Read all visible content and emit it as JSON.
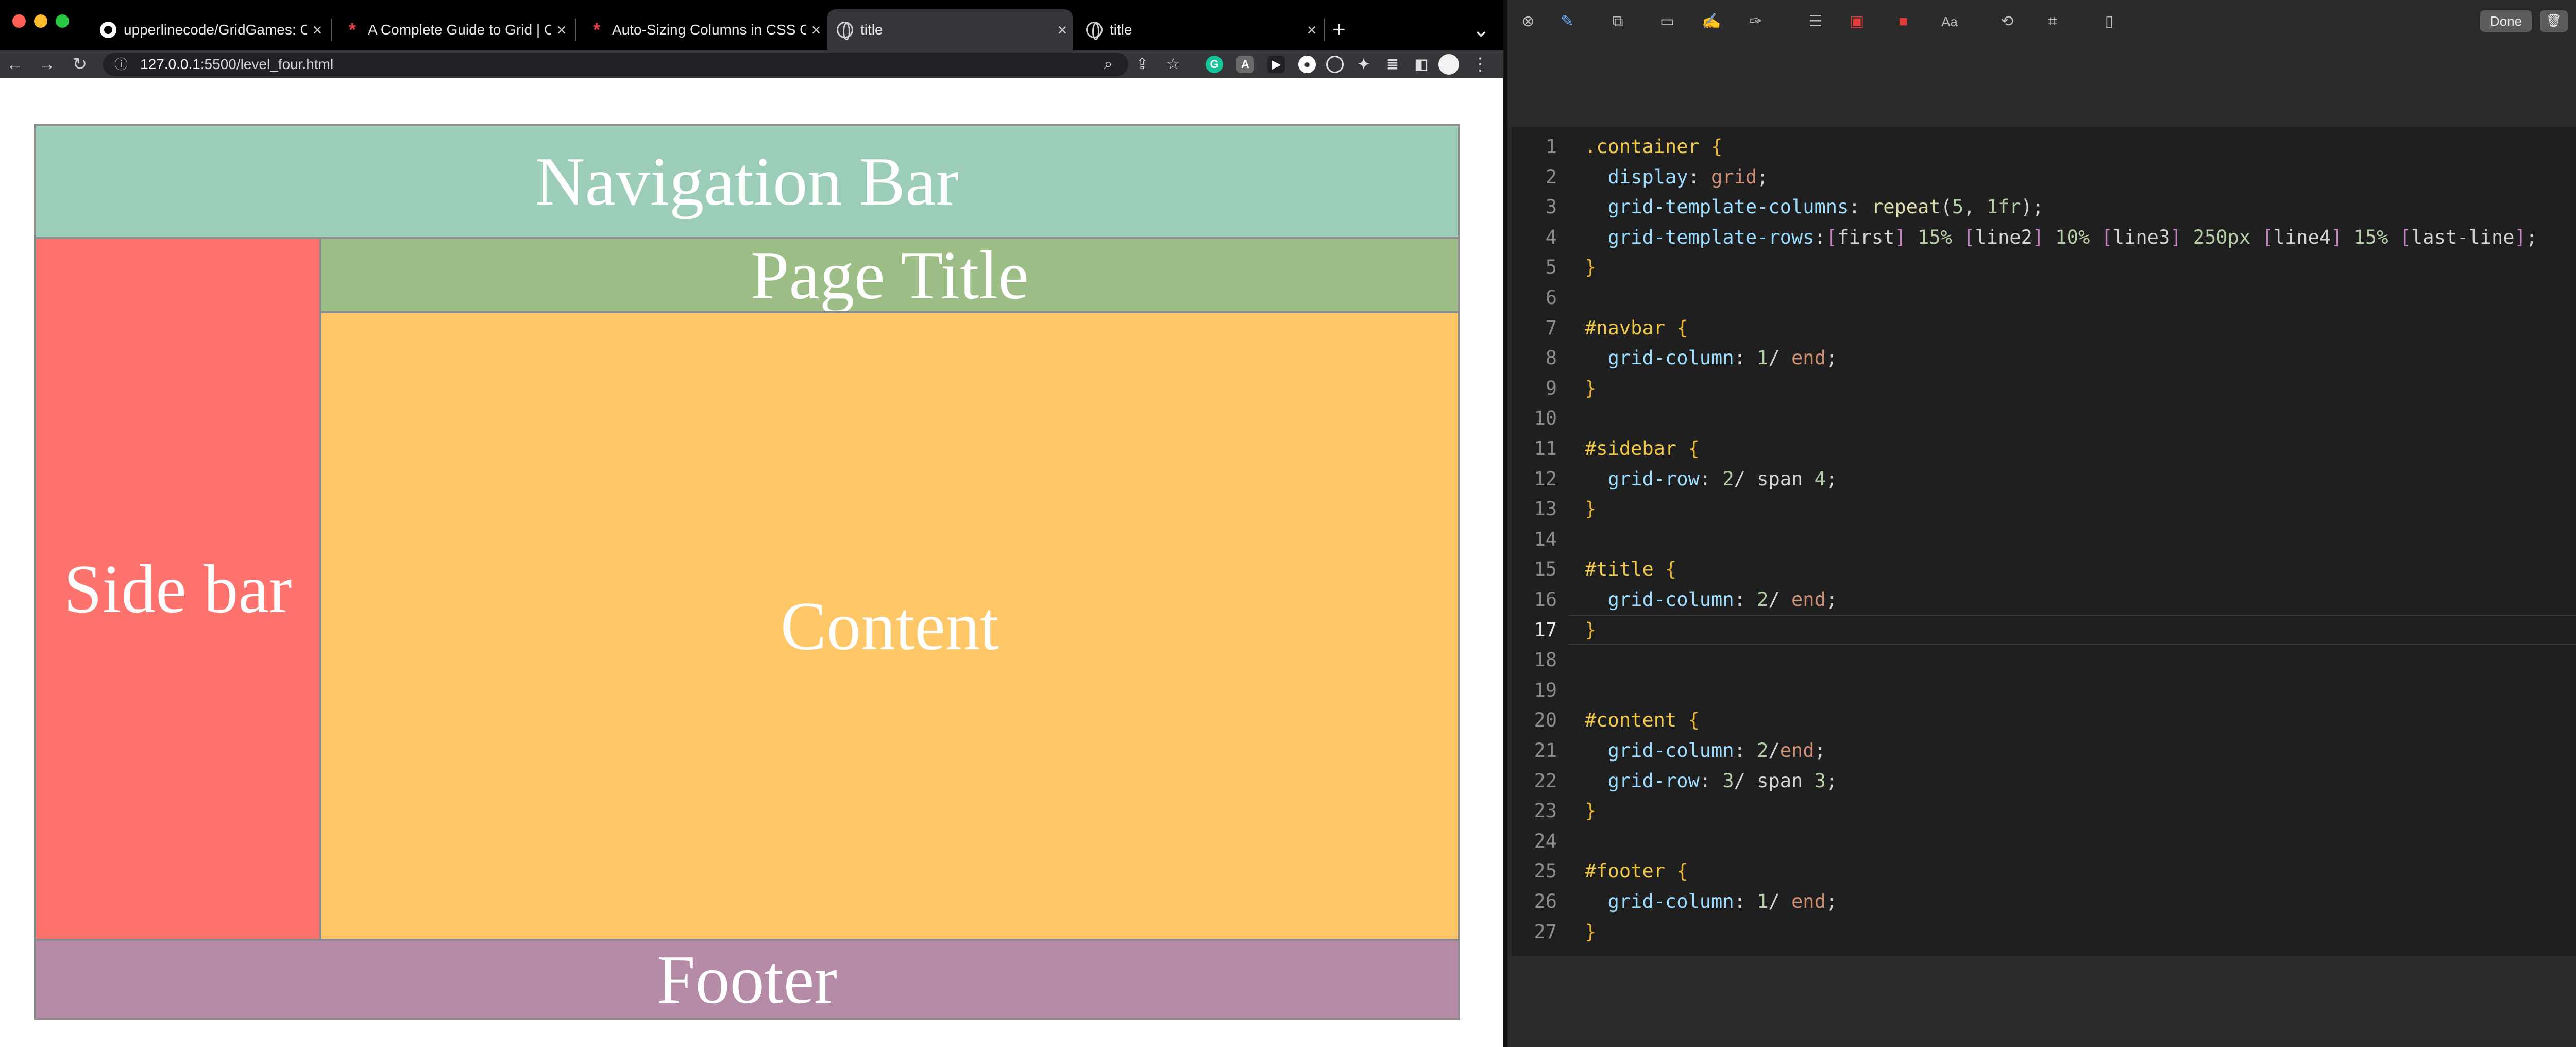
{
  "browser": {
    "tabs": [
      {
        "label": "upperlinecode/GridGames: CS",
        "favicon": "github-icon",
        "active": false
      },
      {
        "label": "A Complete Guide to Grid | CS",
        "favicon": "css-tricks-icon",
        "active": false
      },
      {
        "label": "Auto-Sizing Columns in CSS G",
        "favicon": "css-tricks-icon",
        "active": false
      },
      {
        "label": "title",
        "favicon": "globe-icon",
        "active": true
      },
      {
        "label": "title",
        "favicon": "globe-icon",
        "active": false
      }
    ],
    "new_tab_label": "+",
    "tab_list_label": "⌄",
    "url_host": "127.0.0.1",
    "url_rest": ":5500/level_four.html"
  },
  "page": {
    "navbar": "Navigation Bar",
    "sidebar": "Side bar",
    "title": "Page Title",
    "content": "Content",
    "footer": "Footer",
    "colors": {
      "navbar": "#9ccdb8",
      "sidebar": "#fe736e",
      "title": "#9dbd87",
      "content": "#fec868",
      "footer": "#b58aa6"
    }
  },
  "editor": {
    "done_label": "Done",
    "current_line": 17,
    "code_lines": [
      [
        {
          "t": ".container",
          "c": "sel"
        },
        {
          "t": " {",
          "c": "brk"
        }
      ],
      [
        {
          "t": "  "
        },
        {
          "t": "display",
          "c": "prop"
        },
        {
          "t": ": "
        },
        {
          "t": "grid",
          "c": "val"
        },
        {
          "t": ";"
        }
      ],
      [
        {
          "t": "  "
        },
        {
          "t": "grid-template-columns",
          "c": "prop"
        },
        {
          "t": ": "
        },
        {
          "t": "repeat",
          "c": "fn"
        },
        {
          "t": "("
        },
        {
          "t": "5",
          "c": "num"
        },
        {
          "t": ", "
        },
        {
          "t": "1fr",
          "c": "num"
        },
        {
          "t": ");"
        }
      ],
      [
        {
          "t": "  "
        },
        {
          "t": "grid-template-rows",
          "c": "prop"
        },
        {
          "t": ":"
        },
        {
          "t": "[",
          "c": "lnm"
        },
        {
          "t": "first"
        },
        {
          "t": "]",
          "c": "lnm"
        },
        {
          "t": " "
        },
        {
          "t": "15%",
          "c": "num"
        },
        {
          "t": " "
        },
        {
          "t": "[",
          "c": "lnm"
        },
        {
          "t": "line2"
        },
        {
          "t": "]",
          "c": "lnm"
        },
        {
          "t": " "
        },
        {
          "t": "10%",
          "c": "num"
        },
        {
          "t": " "
        },
        {
          "t": "[",
          "c": "lnm"
        },
        {
          "t": "line3"
        },
        {
          "t": "]",
          "c": "lnm"
        },
        {
          "t": " "
        },
        {
          "t": "250px",
          "c": "num"
        },
        {
          "t": " "
        },
        {
          "t": "[",
          "c": "lnm"
        },
        {
          "t": "line4"
        },
        {
          "t": "]",
          "c": "lnm"
        },
        {
          "t": " "
        },
        {
          "t": "15%",
          "c": "num"
        },
        {
          "t": " "
        },
        {
          "t": "[",
          "c": "lnm"
        },
        {
          "t": "last-line"
        },
        {
          "t": "]",
          "c": "lnm"
        },
        {
          "t": ";"
        }
      ],
      [
        {
          "t": "}",
          "c": "brk"
        }
      ],
      [],
      [
        {
          "t": "#navbar",
          "c": "sel"
        },
        {
          "t": " {",
          "c": "brk"
        }
      ],
      [
        {
          "t": "  "
        },
        {
          "t": "grid-column",
          "c": "prop"
        },
        {
          "t": ": "
        },
        {
          "t": "1",
          "c": "num"
        },
        {
          "t": "/ "
        },
        {
          "t": "end",
          "c": "val"
        },
        {
          "t": ";"
        }
      ],
      [
        {
          "t": "}",
          "c": "brk"
        }
      ],
      [],
      [
        {
          "t": "#sidebar",
          "c": "sel"
        },
        {
          "t": " {",
          "c": "brk"
        }
      ],
      [
        {
          "t": "  "
        },
        {
          "t": "grid-row",
          "c": "prop"
        },
        {
          "t": ": "
        },
        {
          "t": "2",
          "c": "num"
        },
        {
          "t": "/ span "
        },
        {
          "t": "4",
          "c": "num"
        },
        {
          "t": ";"
        }
      ],
      [
        {
          "t": "}",
          "c": "brk"
        }
      ],
      [],
      [
        {
          "t": "#title",
          "c": "sel"
        },
        {
          "t": " {",
          "c": "brk"
        }
      ],
      [
        {
          "t": "  "
        },
        {
          "t": "grid-column",
          "c": "prop"
        },
        {
          "t": ": "
        },
        {
          "t": "2",
          "c": "num"
        },
        {
          "t": "/ "
        },
        {
          "t": "end",
          "c": "val"
        },
        {
          "t": ";"
        }
      ],
      [
        {
          "t": "}",
          "c": "brk"
        }
      ],
      [],
      [],
      [
        {
          "t": "#content",
          "c": "sel"
        },
        {
          "t": " {",
          "c": "brk"
        }
      ],
      [
        {
          "t": "  "
        },
        {
          "t": "grid-column",
          "c": "prop"
        },
        {
          "t": ": "
        },
        {
          "t": "2",
          "c": "num"
        },
        {
          "t": "/"
        },
        {
          "t": "end",
          "c": "val"
        },
        {
          "t": ";"
        }
      ],
      [
        {
          "t": "  "
        },
        {
          "t": "grid-row",
          "c": "prop"
        },
        {
          "t": ": "
        },
        {
          "t": "3",
          "c": "num"
        },
        {
          "t": "/ span "
        },
        {
          "t": "3",
          "c": "num"
        },
        {
          "t": ";"
        }
      ],
      [
        {
          "t": "}",
          "c": "brk"
        }
      ],
      [],
      [
        {
          "t": "#footer",
          "c": "sel"
        },
        {
          "t": " {",
          "c": "brk"
        }
      ],
      [
        {
          "t": "  "
        },
        {
          "t": "grid-column",
          "c": "prop"
        },
        {
          "t": ": "
        },
        {
          "t": "1",
          "c": "num"
        },
        {
          "t": "/ "
        },
        {
          "t": "end",
          "c": "val"
        },
        {
          "t": ";"
        }
      ],
      [
        {
          "t": "}",
          "c": "brk"
        }
      ]
    ]
  }
}
